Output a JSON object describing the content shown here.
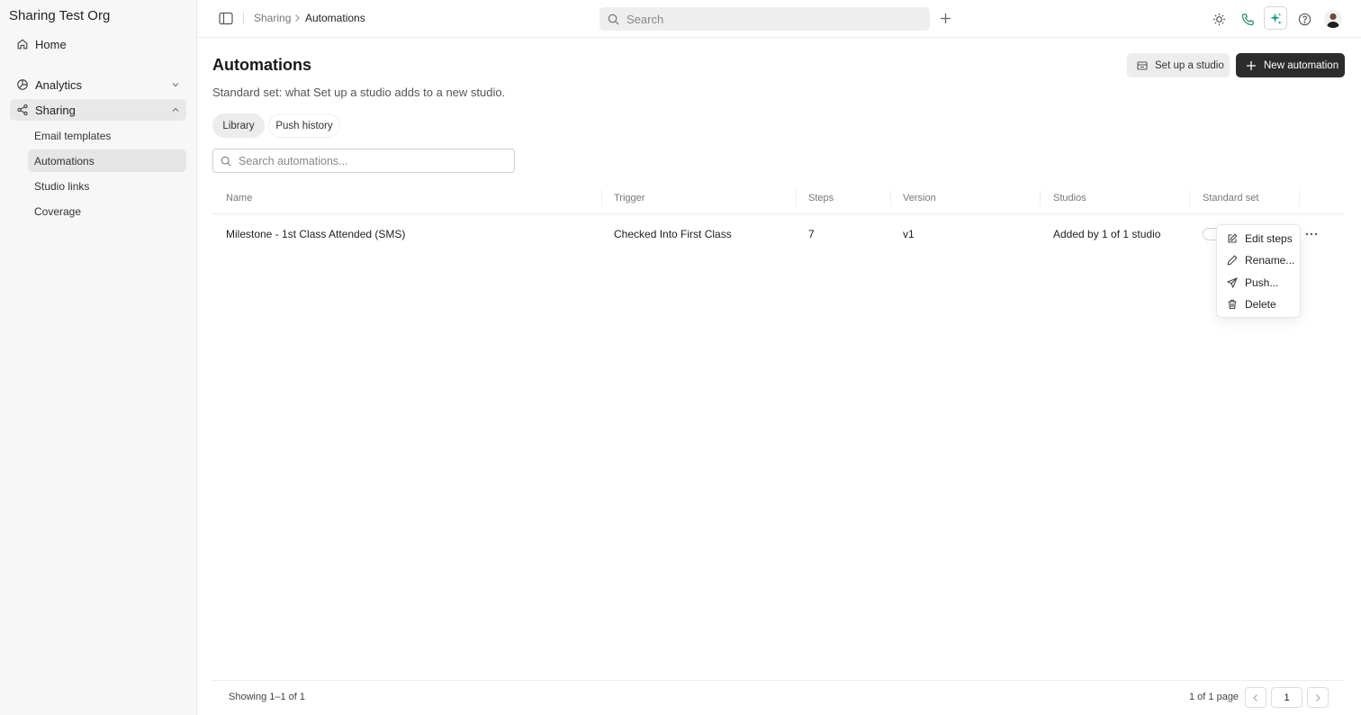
{
  "sidebar": {
    "org_name": "Sharing Test Org",
    "home": "Home",
    "analytics": "Analytics",
    "sharing": "Sharing",
    "sub_items": [
      "Email templates",
      "Automations",
      "Studio links",
      "Coverage"
    ]
  },
  "topbar": {
    "breadcrumb": [
      "Sharing",
      "Automations"
    ],
    "search_placeholder": "Search"
  },
  "page": {
    "title": "Automations",
    "description": "Standard set: what Set up a studio adds to a new studio.",
    "setup_button": "Set up a studio",
    "new_button": "New automation",
    "tabs": [
      "Library",
      "Push history"
    ],
    "search_placeholder": "Search automations..."
  },
  "table": {
    "columns": [
      "Name",
      "Trigger",
      "Steps",
      "Version",
      "Studios",
      "Standard set"
    ],
    "rows": [
      {
        "name": "Milestone - 1st Class Attended (SMS)",
        "trigger": "Checked Into First Class",
        "steps": "7",
        "version": "v1",
        "studios": "Added by 1 of 1 studio"
      }
    ]
  },
  "menu": {
    "items": [
      "Edit steps",
      "Rename...",
      "Push...",
      "Delete"
    ]
  },
  "footer": {
    "showing": "Showing 1–1 of 1",
    "page_info": "1 of 1 page",
    "page_number": "1"
  },
  "colors": {
    "primary_button": "#2c2c2c",
    "accent_teal": "#2a9d8a",
    "phone_green": "#2a8a6a"
  }
}
